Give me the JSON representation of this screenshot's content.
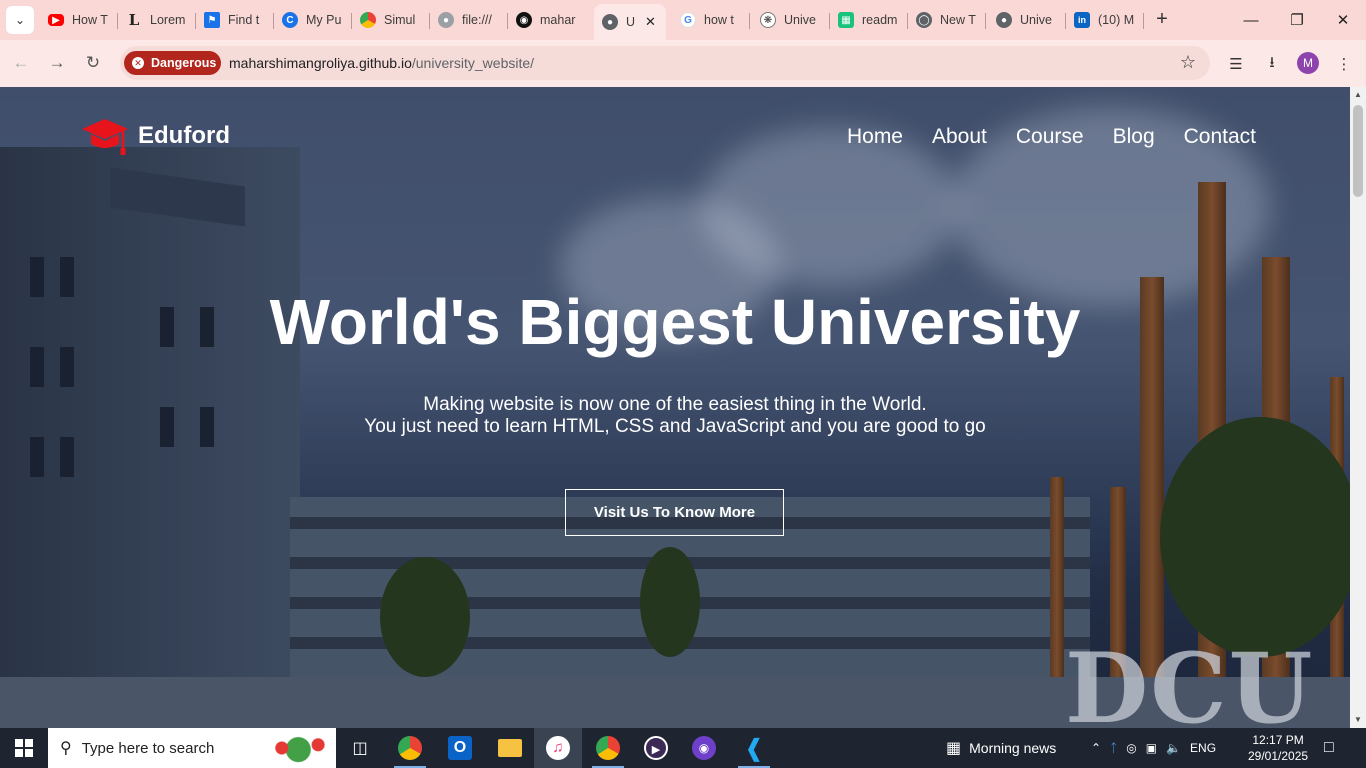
{
  "tabs": [
    {
      "label": "How T",
      "icon": "youtube-icon",
      "color": "#ff0000"
    },
    {
      "label": "Lorem",
      "icon": "lorem-l-icon",
      "color": "#222222"
    },
    {
      "label": "Find t",
      "icon": "flag-icon",
      "color": "#1a73e8"
    },
    {
      "label": "My Pu",
      "icon": "c-logo-icon",
      "color": "#1a73e8"
    },
    {
      "label": "Simul",
      "icon": "chrome-icon",
      "color": "#34a853"
    },
    {
      "label": "file:///",
      "icon": "globe-icon",
      "color": "#5f6368"
    },
    {
      "label": "mahar",
      "icon": "github-icon",
      "color": "#111111"
    },
    {
      "label": "U",
      "icon": "globe-icon",
      "color": "#5f6368"
    },
    {
      "label": "how t",
      "icon": "google-icon",
      "color": "#4285f4"
    },
    {
      "label": "Unive",
      "icon": "openai-icon",
      "color": "#333333"
    },
    {
      "label": "readm",
      "icon": "sheet-icon",
      "color": "#19c37d"
    },
    {
      "label": "New T",
      "icon": "chrome-icon",
      "color": "#5f6368"
    },
    {
      "label": "Unive",
      "icon": "globe-icon",
      "color": "#5f6368"
    },
    {
      "label": "(10) M",
      "icon": "linkedin-icon",
      "color": "#0a66c2"
    }
  ],
  "address_bar": {
    "security_label": "Dangerous",
    "domain": "maharshimangroliya.github.io",
    "path": "/university_website/"
  },
  "profile_initial": "M",
  "site": {
    "logo_text": "Eduford",
    "nav": [
      "Home",
      "About",
      "Course",
      "Blog",
      "Contact"
    ],
    "hero_title": "World's Biggest University",
    "hero_sub_line1": "Making website is now one of the easiest thing in the World.",
    "hero_sub_line2": "You just need to learn HTML, CSS and JavaScript and you are good to go",
    "cta_label": "Visit Us To Know More",
    "background_sign": "DCU"
  },
  "taskbar": {
    "search_placeholder": "Type here to search",
    "news_label": "Morning news",
    "language": "ENG",
    "time": "12:17 PM",
    "date": "29/01/2025"
  }
}
